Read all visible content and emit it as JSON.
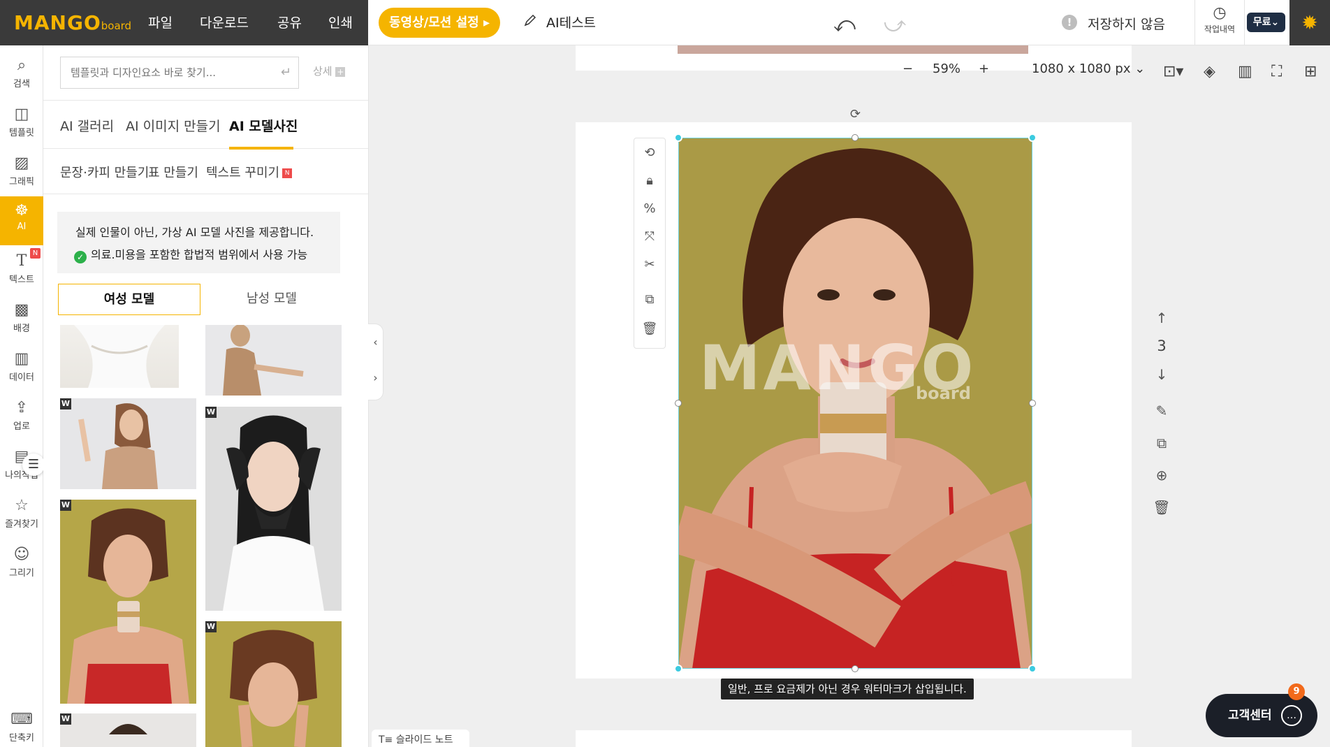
{
  "brand": {
    "logo_main": "MANGO",
    "logo_sub": "board"
  },
  "topmenu": {
    "file": "파일",
    "download": "다운로드",
    "share": "공유",
    "print": "인쇄"
  },
  "motion_button": "동영상/모션 설정 ▸",
  "doc_title": "AI테스트",
  "save_status": "저장하지 않음",
  "history_label": "작업내역",
  "plan_label": "무료",
  "rail": [
    {
      "label": "검색",
      "icon": "search-icon"
    },
    {
      "label": "템플릿",
      "icon": "template-icon"
    },
    {
      "label": "그래픽",
      "icon": "graphic-icon"
    },
    {
      "label": "AI",
      "icon": "ai-icon"
    },
    {
      "label": "텍스트",
      "icon": "text-icon"
    },
    {
      "label": "배경",
      "icon": "background-icon"
    },
    {
      "label": "데이터",
      "icon": "data-icon"
    },
    {
      "label": "업로",
      "icon": "upload-icon"
    },
    {
      "label": "나의작업",
      "icon": "my-work-icon"
    },
    {
      "label": "즐겨찾기",
      "icon": "star-icon"
    },
    {
      "label": "그리기",
      "icon": "draw-icon"
    },
    {
      "label": "단축키",
      "icon": "keyboard-icon"
    }
  ],
  "rail_new_badge": "N",
  "search": {
    "placeholder": "템플릿과 디자인요소 바로 찾기...",
    "detail": "상세"
  },
  "tabs1": [
    "AI 갤러리",
    "AI 이미지 만들기",
    "AI 모델사진"
  ],
  "tabs2": [
    "문장·카피 만들기",
    "표 만들기",
    "텍스트 꾸미기"
  ],
  "new_badge": "N",
  "notice": {
    "line1": "실제 인물이 아닌, 가상 AI 모델 사진을 제공합니다.",
    "line2": "의료.미용을 포함한 합법적 범위에서 사용 가능"
  },
  "gender": {
    "female": "여성 모델",
    "male": "남성 모델"
  },
  "w_badge": "W",
  "zoom": {
    "minus": "−",
    "value": "59%",
    "plus": "+",
    "size": "1080 x 1080 px"
  },
  "watermark_text": "MANGO",
  "watermark_sub": "board",
  "watermark_tip": "일반, 프로 요금제가 아닌 경우 워터마크가 삽입됩니다.",
  "page_number": "3",
  "slide_note": "슬라이드 노트",
  "customer_center": "고객센터",
  "cs_badge": "9",
  "colors": {
    "accent": "#f5b400",
    "dark": "#3a3a3a",
    "selection": "#3ccbe0",
    "photo_bg": "#aa9a46",
    "dress": "#c62323"
  }
}
